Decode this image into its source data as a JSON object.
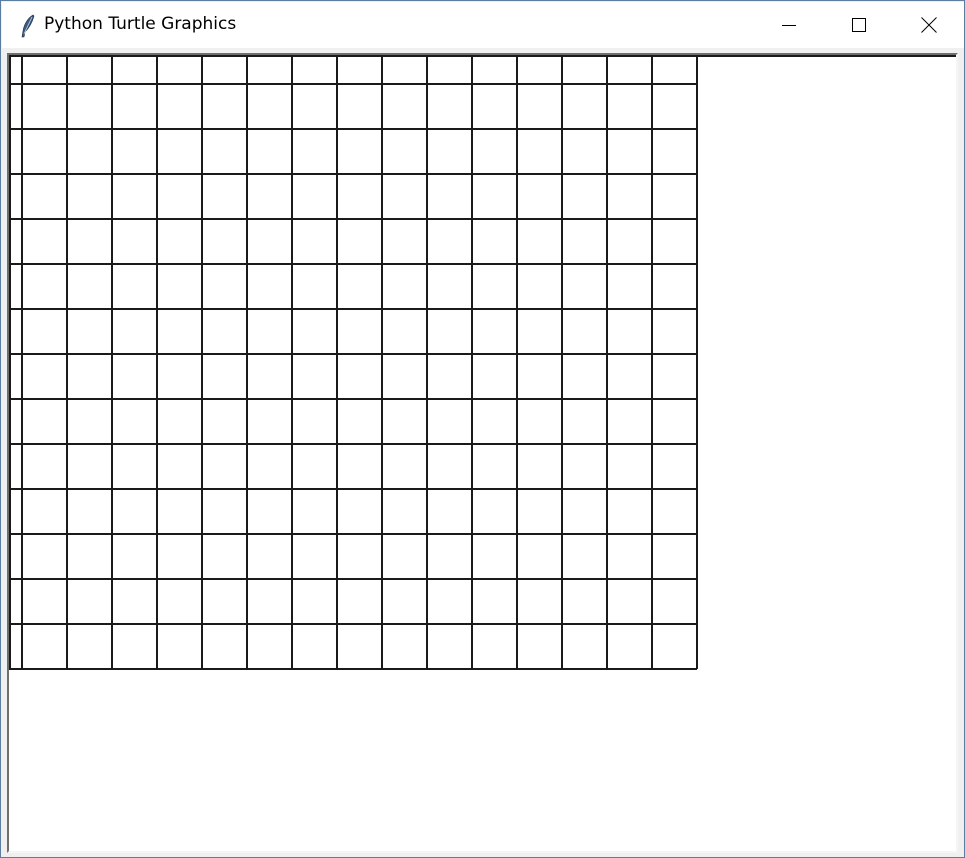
{
  "window": {
    "title": "Python Turtle Graphics",
    "icon": "feather-icon",
    "controls": {
      "minimize": "minimize-icon",
      "maximize": "maximize-icon",
      "close": "close-icon"
    }
  },
  "canvas": {
    "background": "#ffffff",
    "line_color": "#1a1a1a",
    "grid": {
      "columns": 15,
      "rows": 13,
      "extra_narrow_left_column": true,
      "extra_partial_top_row": true
    }
  }
}
